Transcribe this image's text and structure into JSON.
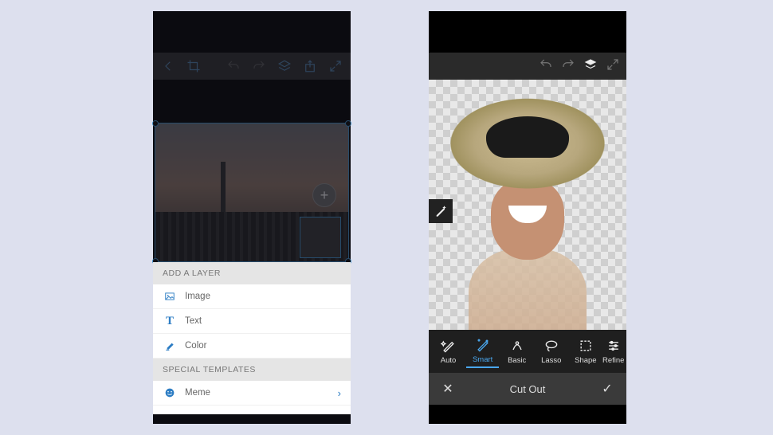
{
  "left": {
    "menu": {
      "header_layer": "ADD A LAYER",
      "items": [
        {
          "icon": "image-icon",
          "label": "Image"
        },
        {
          "icon": "text-icon",
          "label": "Text"
        },
        {
          "icon": "color-icon",
          "label": "Color"
        }
      ],
      "header_templates": "SPECIAL TEMPLATES",
      "templates": [
        {
          "icon": "meme-icon",
          "label": "Meme"
        }
      ]
    },
    "add_glyph": "+"
  },
  "right": {
    "tools": [
      {
        "key": "auto",
        "label": "Auto"
      },
      {
        "key": "smart",
        "label": "Smart"
      },
      {
        "key": "basic",
        "label": "Basic"
      },
      {
        "key": "lasso",
        "label": "Lasso"
      },
      {
        "key": "shape",
        "label": "Shape"
      },
      {
        "key": "refine",
        "label": "Refine"
      }
    ],
    "active_tool": "smart",
    "confirm": {
      "cancel": "✕",
      "title": "Cut Out",
      "ok": "✓"
    }
  }
}
